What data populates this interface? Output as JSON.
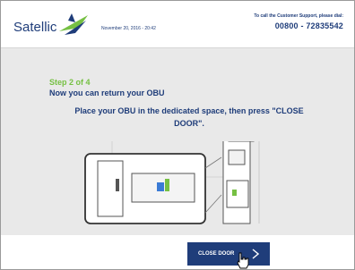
{
  "header": {
    "logo_text": "Satellic",
    "datetime": "November 20, 2016 - 20:42",
    "support_label": "To call the Customer Support, please dial:",
    "support_phone": "00800 - 72835542"
  },
  "main": {
    "step": "Step 2 of 4",
    "subtitle": "Now you can return your OBU",
    "instruction": "Place your OBU in the dedicated space, then press \"CLOSE DOOR\"."
  },
  "footer": {
    "close_door_label": "CLOSE DOOR"
  },
  "icons": {
    "logo_mark": "satellic-logo-icon",
    "button_arrow": "chevron-right-icon",
    "cursor": "hand-pointer-icon"
  },
  "colors": {
    "brand_navy": "#1f3d7a",
    "accent_green": "#76c043",
    "content_bg": "#e9e9e9"
  }
}
